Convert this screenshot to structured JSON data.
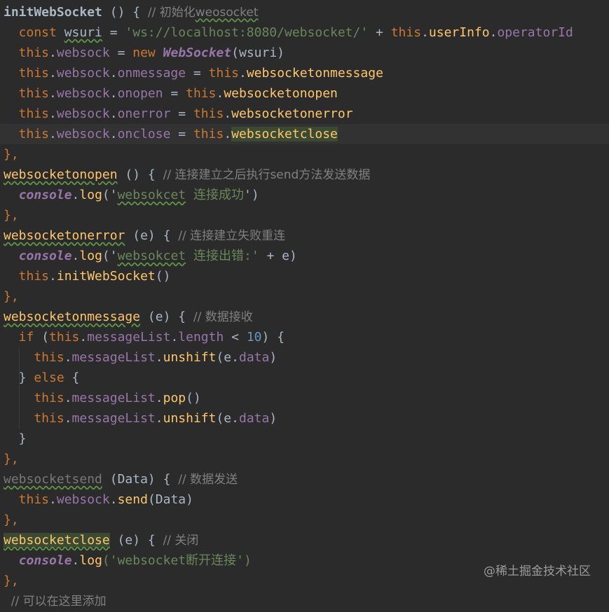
{
  "editor": {
    "language": "JavaScript",
    "current_line": 7,
    "lines": [
      [
        {
          "t": "initWebSocket",
          "c": "pl bold"
        },
        {
          "t": " () { ",
          "c": "pl"
        },
        {
          "t": "// 初始化",
          "c": "cm"
        },
        {
          "t": "weosocket",
          "c": "cm typo"
        }
      ],
      [
        {
          "t": "  const ",
          "c": "kw"
        },
        {
          "t": "wsuri",
          "c": "pl typo"
        },
        {
          "t": " = ",
          "c": "pl"
        },
        {
          "t": "'ws://localhost:8080/websocket/'",
          "c": "str"
        },
        {
          "t": " + ",
          "c": "pl"
        },
        {
          "t": "this",
          "c": "kw"
        },
        {
          "t": ".",
          "c": "pl"
        },
        {
          "t": "userInfo",
          "c": "fn"
        },
        {
          "t": ".",
          "c": "pl"
        },
        {
          "t": "operatorId",
          "c": "prop"
        }
      ],
      [
        {
          "t": "  this",
          "c": "kw"
        },
        {
          "t": ".",
          "c": "pl"
        },
        {
          "t": "websock",
          "c": "prop"
        },
        {
          "t": " = ",
          "c": "pl"
        },
        {
          "t": "new ",
          "c": "kw"
        },
        {
          "t": "WebSocket",
          "c": "cls"
        },
        {
          "t": "(wsuri)",
          "c": "pl"
        }
      ],
      [
        {
          "t": "  this",
          "c": "kw"
        },
        {
          "t": ".",
          "c": "pl"
        },
        {
          "t": "websock",
          "c": "prop"
        },
        {
          "t": ".",
          "c": "pl"
        },
        {
          "t": "onmessage",
          "c": "prop"
        },
        {
          "t": " = ",
          "c": "pl"
        },
        {
          "t": "this",
          "c": "kw"
        },
        {
          "t": ".",
          "c": "pl"
        },
        {
          "t": "websocketonmessage",
          "c": "fn"
        }
      ],
      [
        {
          "t": "  this",
          "c": "kw"
        },
        {
          "t": ".",
          "c": "pl"
        },
        {
          "t": "websock",
          "c": "prop"
        },
        {
          "t": ".",
          "c": "pl"
        },
        {
          "t": "onopen",
          "c": "prop"
        },
        {
          "t": " = ",
          "c": "pl"
        },
        {
          "t": "this",
          "c": "kw"
        },
        {
          "t": ".",
          "c": "pl"
        },
        {
          "t": "websocketonopen",
          "c": "fn"
        }
      ],
      [
        {
          "t": "  this",
          "c": "kw"
        },
        {
          "t": ".",
          "c": "pl"
        },
        {
          "t": "websock",
          "c": "prop"
        },
        {
          "t": ".",
          "c": "pl"
        },
        {
          "t": "onerror",
          "c": "prop"
        },
        {
          "t": " = ",
          "c": "pl"
        },
        {
          "t": "this",
          "c": "kw"
        },
        {
          "t": ".",
          "c": "pl"
        },
        {
          "t": "websocketonerror",
          "c": "fn"
        }
      ],
      [
        {
          "t": "  this",
          "c": "kw"
        },
        {
          "t": ".",
          "c": "pl"
        },
        {
          "t": "websock",
          "c": "prop"
        },
        {
          "t": ".",
          "c": "pl"
        },
        {
          "t": "onclose",
          "c": "prop"
        },
        {
          "t": " = ",
          "c": "pl"
        },
        {
          "t": "this",
          "c": "kw"
        },
        {
          "t": ".",
          "c": "pl"
        },
        {
          "t": "websocketclose",
          "c": "fn hl"
        }
      ],
      [
        {
          "t": "},",
          "c": "kw"
        }
      ],
      [
        {
          "t": "websocketonopen",
          "c": "fn typo"
        },
        {
          "t": " () { ",
          "c": "pl"
        },
        {
          "t": "// 连接建立之后执行send方法发送数据",
          "c": "cm"
        }
      ],
      [
        {
          "t": "  ",
          "c": "pl"
        },
        {
          "t": "console",
          "c": "con"
        },
        {
          "t": ".",
          "c": "pl"
        },
        {
          "t": "log",
          "c": "fn"
        },
        {
          "t": "('",
          "c": "pl"
        },
        {
          "t": "websokcet",
          "c": "str typo"
        },
        {
          "t": " 连接成功",
          "c": "str"
        },
        {
          "t": "')",
          "c": "pl"
        }
      ],
      [
        {
          "t": "},",
          "c": "kw"
        }
      ],
      [
        {
          "t": "websocketonerror",
          "c": "fn typo"
        },
        {
          "t": " (e) { ",
          "c": "pl"
        },
        {
          "t": "// 连接建立失败重连",
          "c": "cm"
        }
      ],
      [
        {
          "t": "  ",
          "c": "pl"
        },
        {
          "t": "console",
          "c": "con"
        },
        {
          "t": ".",
          "c": "pl"
        },
        {
          "t": "log",
          "c": "fn"
        },
        {
          "t": "('",
          "c": "pl"
        },
        {
          "t": "websokcet",
          "c": "str typo"
        },
        {
          "t": " 连接出错:'",
          "c": "str"
        },
        {
          "t": " + e)",
          "c": "pl"
        }
      ],
      [
        {
          "t": "  this",
          "c": "kw"
        },
        {
          "t": ".",
          "c": "pl"
        },
        {
          "t": "initWebSocket",
          "c": "fn"
        },
        {
          "t": "()",
          "c": "pl"
        }
      ],
      [
        {
          "t": "},",
          "c": "kw"
        }
      ],
      [
        {
          "t": "websocketonmessage",
          "c": "fn typo"
        },
        {
          "t": " (e) { ",
          "c": "pl"
        },
        {
          "t": "// 数据接收",
          "c": "cm"
        }
      ],
      [
        {
          "t": "  if ",
          "c": "kw"
        },
        {
          "t": "(",
          "c": "pl"
        },
        {
          "t": "this",
          "c": "kw"
        },
        {
          "t": ".",
          "c": "pl"
        },
        {
          "t": "messageList",
          "c": "prop"
        },
        {
          "t": ".",
          "c": "pl"
        },
        {
          "t": "length",
          "c": "prop"
        },
        {
          "t": " < ",
          "c": "pl"
        },
        {
          "t": "10",
          "c": "num"
        },
        {
          "t": ") {",
          "c": "pl"
        }
      ],
      [
        {
          "t": "    this",
          "c": "kw"
        },
        {
          "t": ".",
          "c": "pl"
        },
        {
          "t": "messageList",
          "c": "prop"
        },
        {
          "t": ".",
          "c": "pl"
        },
        {
          "t": "unshift",
          "c": "fn"
        },
        {
          "t": "(e.",
          "c": "pl"
        },
        {
          "t": "data",
          "c": "prop"
        },
        {
          "t": ")",
          "c": "pl"
        }
      ],
      [
        {
          "t": "  } ",
          "c": "pl"
        },
        {
          "t": "else",
          "c": "kw"
        },
        {
          "t": " {",
          "c": "pl"
        }
      ],
      [
        {
          "t": "    this",
          "c": "kw"
        },
        {
          "t": ".",
          "c": "pl"
        },
        {
          "t": "messageList",
          "c": "prop"
        },
        {
          "t": ".",
          "c": "pl"
        },
        {
          "t": "pop",
          "c": "fn"
        },
        {
          "t": "()",
          "c": "pl"
        }
      ],
      [
        {
          "t": "    this",
          "c": "kw"
        },
        {
          "t": ".",
          "c": "pl"
        },
        {
          "t": "messageList",
          "c": "prop"
        },
        {
          "t": ".",
          "c": "pl"
        },
        {
          "t": "unshift",
          "c": "fn"
        },
        {
          "t": "(e.",
          "c": "pl"
        },
        {
          "t": "data",
          "c": "prop"
        },
        {
          "t": ")",
          "c": "pl"
        }
      ],
      [
        {
          "t": "  }",
          "c": "pl"
        }
      ],
      [
        {
          "t": "},",
          "c": "kw"
        }
      ],
      [
        {
          "t": "websocketsend",
          "c": "dim typo"
        },
        {
          "t": " (Data) { ",
          "c": "pl"
        },
        {
          "t": "// 数据发送",
          "c": "cm"
        }
      ],
      [
        {
          "t": "  this",
          "c": "kw"
        },
        {
          "t": ".",
          "c": "pl"
        },
        {
          "t": "websock",
          "c": "prop"
        },
        {
          "t": ".",
          "c": "pl"
        },
        {
          "t": "send",
          "c": "fn"
        },
        {
          "t": "(Data)",
          "c": "pl"
        }
      ],
      [
        {
          "t": "},",
          "c": "kw"
        }
      ],
      [
        {
          "t": "websocketclose",
          "c": "fn typo hl"
        },
        {
          "t": " (e) { ",
          "c": "pl"
        },
        {
          "t": "// 关闭",
          "c": "cm"
        }
      ],
      [
        {
          "t": "  ",
          "c": "pl"
        },
        {
          "t": "console",
          "c": "con"
        },
        {
          "t": ".",
          "c": "pl"
        },
        {
          "t": "log",
          "c": "fn"
        },
        {
          "t": "('websocket断开连接')",
          "c": "str"
        }
      ],
      [
        {
          "t": "},",
          "c": "kw"
        }
      ],
      [
        {
          "t": "  // 可以在这里添加",
          "c": "cm"
        }
      ]
    ]
  },
  "watermark": {
    "text": "@稀土掘金技术社区"
  },
  "colors": {
    "background": "#2b2b2b",
    "keyword": "#cc7832",
    "function": "#ffc66d",
    "property": "#9876aa",
    "string": "#6a8759",
    "number": "#6897bb",
    "comment": "#808080",
    "plain": "#a9b7c6",
    "typo_underline": "#619647"
  }
}
